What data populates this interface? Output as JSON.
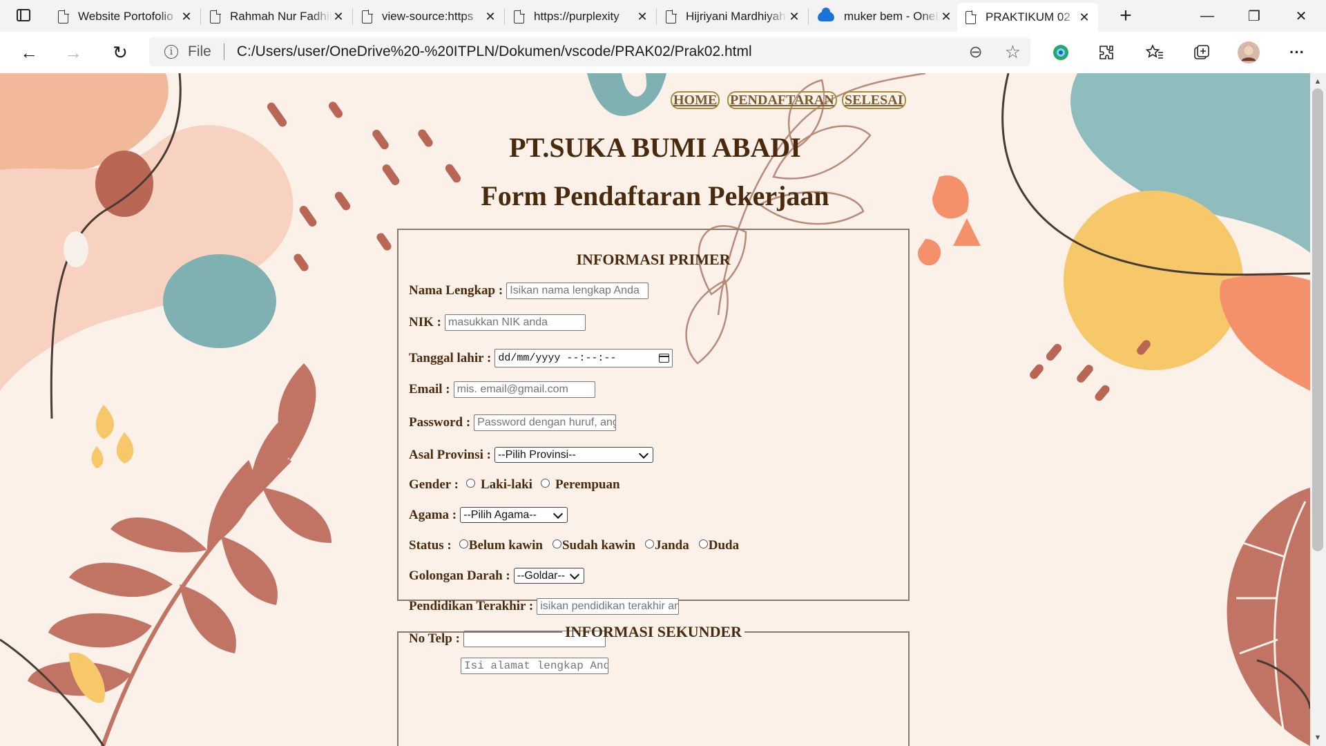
{
  "browser": {
    "tabs": [
      {
        "title": "Website Portofolio",
        "icon": "doc-icon",
        "active": false
      },
      {
        "title": "Rahmah Nur Fadhilah",
        "icon": "doc-icon",
        "active": false
      },
      {
        "title": "view-source:https",
        "icon": "doc-icon",
        "active": false
      },
      {
        "title": "https://purplexity",
        "icon": "doc-icon",
        "active": false
      },
      {
        "title": "Hijriyani Mardhiyah",
        "icon": "doc-icon",
        "active": false
      },
      {
        "title": "muker bem - OneDrive",
        "icon": "cloud-icon",
        "active": false
      },
      {
        "title": "PRAKTIKUM 02",
        "icon": "doc-icon",
        "active": true
      }
    ],
    "close_glyph": "✕",
    "new_tab_glyph": "+",
    "window": {
      "minimize": "—",
      "restore": "❐",
      "close": "✕"
    },
    "nav": {
      "back": "←",
      "forward": "→",
      "reload": "↻"
    },
    "address": {
      "scheme_label": "File",
      "info_glyph": "i",
      "url": "C:/Users/user/OneDrive%20-%20ITPLN/Dokumen/vscode/PRAK02/Prak02.html"
    },
    "toolbar_icons": [
      "zoom-out-icon",
      "add-favorite-icon",
      "extension-icon",
      "extensions-icon",
      "favorites-icon",
      "collections-icon",
      "profile-avatar",
      "more-icon"
    ],
    "toolbar_glyphs": {
      "zoom": "⊖",
      "fav_add": "☆",
      "ext": "✪",
      "puzzle": "⧉",
      "favorites": "☆",
      "collections": "⊞",
      "more": "···"
    }
  },
  "page": {
    "nav_links": [
      "HOME",
      "PENDAFTARAN",
      "SELESAI"
    ],
    "company": "PT.SUKA BUMI ABADI",
    "form_title": "Form Pendaftaran Pekerjaan",
    "primary": {
      "heading": "INFORMASI PRIMER",
      "nama": {
        "label": "Nama Lengkap :",
        "placeholder": "Isikan nama lengkap Anda"
      },
      "nik": {
        "label": "NIK :",
        "placeholder": "masukkan NIK anda"
      },
      "tgl": {
        "label": "Tanggal lahir :",
        "value": "dd/mm/yyyy  --:--:--"
      },
      "email": {
        "label": "Email :",
        "placeholder": "mis. email@gmail.com"
      },
      "password": {
        "label": "Password :",
        "placeholder": "Password dengan huruf, angka"
      },
      "provinsi": {
        "label": "Asal Provinsi :",
        "selected": "--Pilih Provinsi--"
      },
      "gender": {
        "label": "Gender :",
        "options": [
          "Laki-laki",
          "Perempuan"
        ]
      },
      "agama": {
        "label": "Agama :",
        "selected": "--Pilih Agama--"
      },
      "status": {
        "label": "Status :",
        "options": [
          "Belum kawin",
          "Sudah kawin",
          "Janda",
          "Duda"
        ]
      },
      "goldar": {
        "label": "Golongan Darah :",
        "selected": "--Goldar--"
      },
      "pendidikan": {
        "label": "Pendidikan Terakhir :",
        "placeholder": "isikan pendidikan terakhir anda"
      },
      "telp": {
        "label": "No Telp :",
        "value": ""
      }
    },
    "secondary": {
      "heading": "INFORMASI SEKUNDER",
      "alamat_placeholder": "Isi alamat lengkap Anda"
    }
  }
}
